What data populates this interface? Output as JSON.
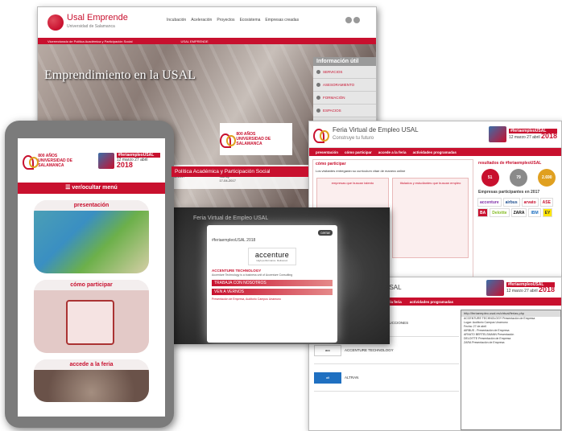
{
  "site": {
    "brand": "Usal Emprende",
    "brand_sub": "Universidad de Salamanca",
    "nav": [
      "Incubación",
      "Aceleración",
      "Proyectos",
      "Ecosistema",
      "Empresas creadas"
    ],
    "breadcrumb": "Vicerrectorado de Política Académica y Participación Social",
    "section_tag": "USAL EMPRENDE",
    "lang": [
      "English",
      "Español"
    ],
    "hero_title": "Emprendimiento en la USAL",
    "info_title": "Información útil",
    "info_items": [
      "SERVICIOS",
      "ASESORAMIENTO",
      "FORMACIÓN",
      "ESPACIOS",
      "EMPLEO"
    ],
    "news": [
      "Ecosistema \"Cero Universidad Emprende\"",
      "Emprendimiento y desarrollo empresarial en el Premio Startup",
      "Actividades"
    ],
    "news_dates": [
      "26-04-2017",
      "17-04-2017"
    ],
    "badge_line1": "800 AÑOS",
    "badge_line2": "UNIVERSIDAD DE SALAMANCA"
  },
  "phone": {
    "hashtag": "#feriaempleoUSAL",
    "date": "12 marzo 27 abril",
    "year": "2018",
    "menu_toggle": "☰ ver/ocultar menú",
    "vpa": "Política Académica y Participación Social",
    "cards": [
      "presentación",
      "cómo participar",
      "accede a la feria"
    ]
  },
  "feria": {
    "title": "Feria Virtual de Empleo USAL",
    "subtitle": "Construye tu futuro",
    "tabs": [
      "presentación",
      "cómo participar",
      "accede a la feria",
      "actividades programadas"
    ],
    "how_title": "cómo participar",
    "blurb": "Los visitantes entregarán su currículum vitae de manera online",
    "companies_box": "empresas que buscan talento",
    "students_box": "titulados y estudiantes que buscan empleo",
    "results_title": "resultados de #feriaempleoUSAL",
    "stats": [
      "51",
      "79",
      "2.690"
    ],
    "participants_title": "Empresas participantes en 2017",
    "logos": [
      "accenture",
      "airbus",
      "arvato",
      "ASE",
      "BA",
      "Deloitte",
      "ZARA",
      "IBM",
      "EY"
    ]
  },
  "modal": {
    "bg_title": "Feria Virtual de Empleo USAL",
    "header": "#feriaempleoUSAL 2018",
    "close": "cerrar",
    "company": "accenture",
    "company_sub": "High performance. Delivered.",
    "section": "ACCENTURE TECHNOLOGY",
    "text": "Accenture Technology is a business unit of Accenture Consulting",
    "band1": "TRABAJA CON NOSOTROS",
    "band2": "VEN A VERNOS",
    "event": "Presentación de Empresa, Auditorio Campus Unamuno"
  },
  "lower": {
    "url": "http://feriaempleo.usal.es/virtual/ferias.php",
    "rows": [
      "ACCENTURE TECHNOLOGY Presentación de Empresa",
      "Lugar: Auditorio Campus Unamuno",
      "Fecha: 27 de abril",
      "AIRBUS - Presentación de Empresa",
      "ARVATO BERTELSMANN Presentación",
      "DELOITTE Presentación de Empresa",
      "ZARA Presentación de Empresa"
    ],
    "items": [
      "METROPOLITAN CONSTRUCCIONES",
      "ACCENTURE TECHNOLOGY",
      "ALTRAN"
    ]
  }
}
